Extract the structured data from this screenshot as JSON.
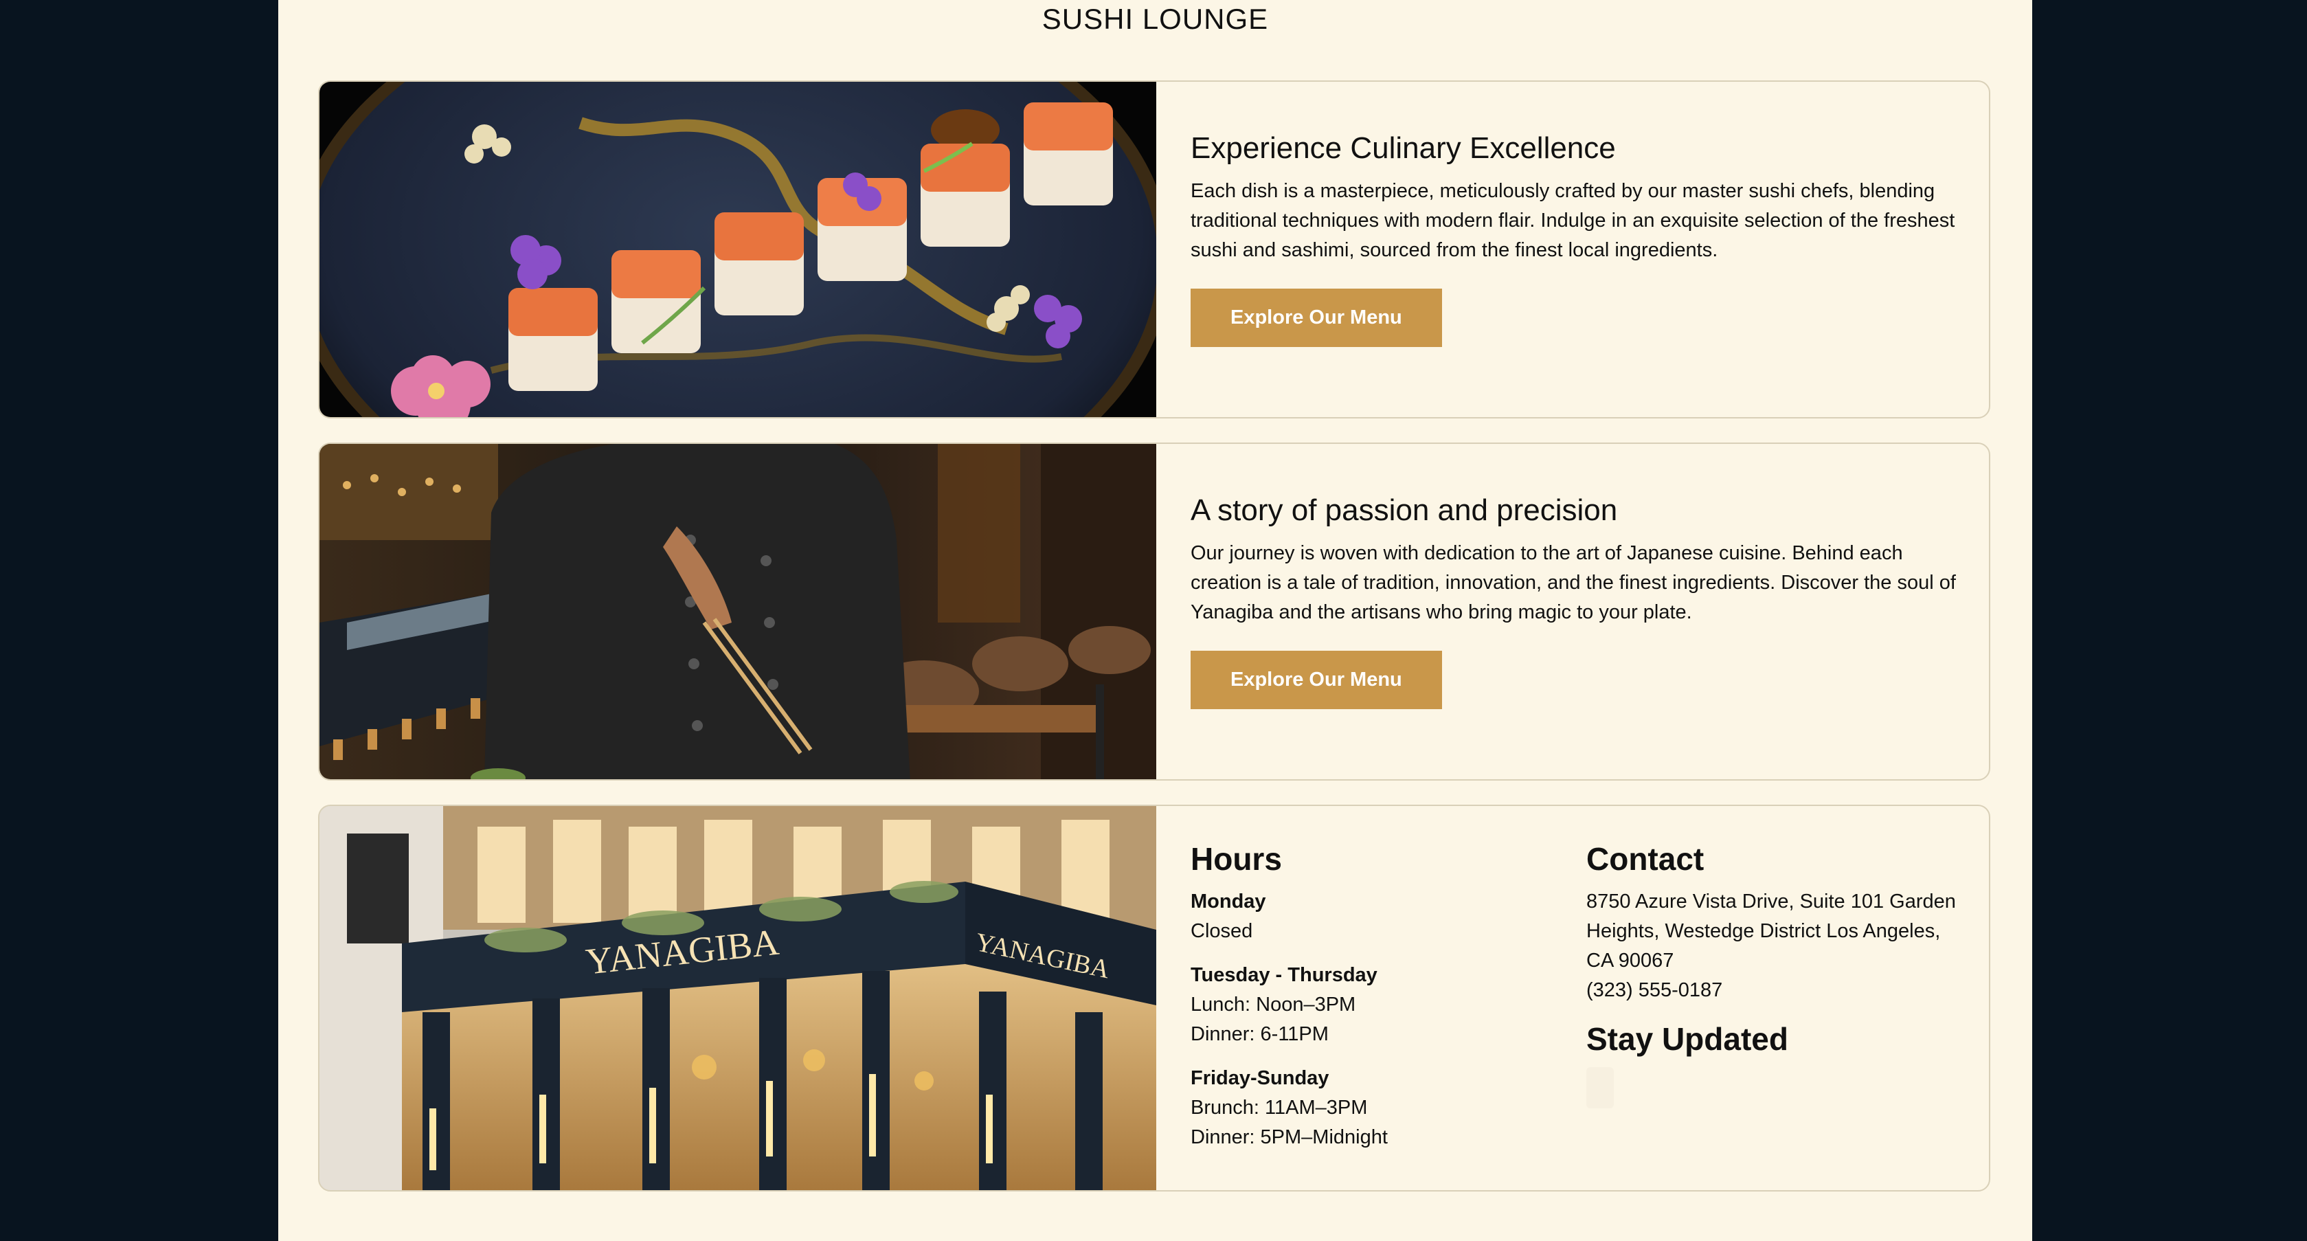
{
  "site": {
    "title": "SUSHI LOUNGE"
  },
  "features": [
    {
      "heading": "Experience Culinary Excellence",
      "text": "Each dish is a masterpiece, meticulously crafted by our master sushi chefs, blending traditional techniques with modern flair. Indulge in an exquisite selection of the freshest sushi and sashimi, sourced from the finest local ingredients.",
      "button": "Explore Our Menu"
    },
    {
      "heading": "A story of passion and precision",
      "text": "Our journey is woven with dedication to the art of Japanese cuisine. Behind each creation is a tale of tradition, innovation, and the finest ingredients. Discover the soul of Yanagiba and the artisans who bring magic to your plate.",
      "button": "Explore Our Menu"
    }
  ],
  "info": {
    "storefront_sign": "YANAGIBA",
    "hours_title": "Hours",
    "hours": [
      {
        "day": "Monday",
        "lines": [
          "Closed"
        ]
      },
      {
        "day": "Tuesday - Thursday",
        "lines": [
          "Lunch: Noon–3PM",
          "Dinner: 6-11PM"
        ]
      },
      {
        "day": "Friday-Sunday",
        "lines": [
          "Brunch: 11AM–3PM",
          "Dinner: 5PM–Midnight"
        ]
      }
    ],
    "contact_title": "Contact",
    "address": "8750 Azure Vista Drive, Suite 101 Garden Heights, Westedge District Los Angeles, CA 90067",
    "phone": "(323) 555-0187",
    "stay_updated_title": "Stay Updated"
  },
  "colors": {
    "page_bg": "#08141f",
    "content_bg": "#fcf6e6",
    "button": "#c9974a",
    "card_border": "#d9d0b8"
  }
}
